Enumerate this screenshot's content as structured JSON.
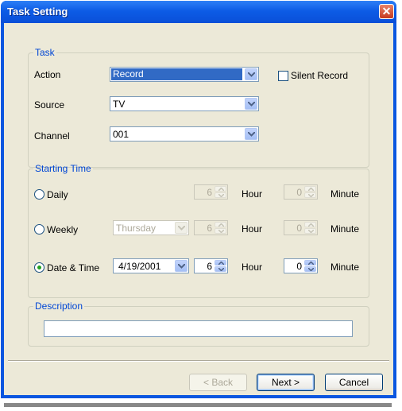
{
  "window": {
    "title": "Task Setting",
    "close_glyph": "✕"
  },
  "task": {
    "legend": "Task",
    "action_label": "Action",
    "action_value": "Record",
    "silent_record_label": "Silent Record",
    "silent_record_checked": false,
    "source_label": "Source",
    "source_value": "TV",
    "channel_label": "Channel",
    "channel_value": "001"
  },
  "starting_time": {
    "legend": "Starting Time",
    "daily": {
      "label": "Daily",
      "selected": false,
      "hour": "6",
      "minute": "0"
    },
    "weekly": {
      "label": "Weekly",
      "selected": false,
      "day": "Thursday",
      "hour": "6",
      "minute": "0"
    },
    "date_time": {
      "label": "Date & Time",
      "selected": true,
      "date": "4/19/2001",
      "hour": "6",
      "minute": "0"
    },
    "hour_label": "Hour",
    "minute_label": "Minute"
  },
  "description": {
    "legend": "Description",
    "value": ""
  },
  "buttons": {
    "back": "< Back",
    "next": "Next >",
    "cancel": "Cancel"
  },
  "colors": {
    "title_bar": "#0a56e0",
    "dialog_bg": "#ece9d8",
    "legend_text": "#0046d5",
    "selection": "#316ac5"
  }
}
